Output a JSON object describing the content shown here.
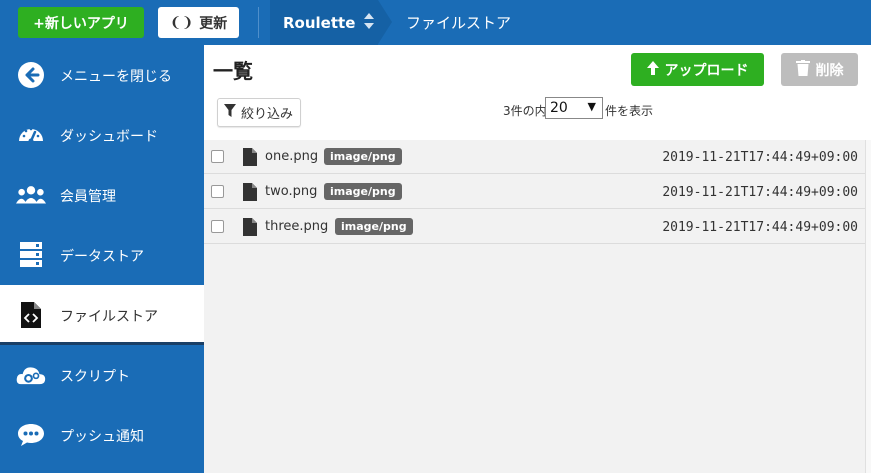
{
  "topbar": {
    "new_app_label": "+新しいアプリ",
    "refresh_label": "更新",
    "app_name": "Roulette",
    "breadcrumb": "ファイルストア"
  },
  "sidebar": {
    "items": [
      {
        "label": "メニューを閉じる",
        "icon": "arrow-left-circle-icon"
      },
      {
        "label": "ダッシュボード",
        "icon": "gauge-icon"
      },
      {
        "label": "会員管理",
        "icon": "users-icon"
      },
      {
        "label": "データストア",
        "icon": "database-icon"
      },
      {
        "label": "ファイルストア",
        "icon": "file-code-icon"
      },
      {
        "label": "スクリプト",
        "icon": "cloud-gears-icon"
      },
      {
        "label": "プッシュ通知",
        "icon": "chat-bubble-icon"
      }
    ]
  },
  "main": {
    "title": "一覧",
    "upload_label": "アップロード",
    "delete_label": "削除",
    "filter_label": "絞り込み",
    "count_text": "3件の内",
    "per_page_value": "20",
    "show_text": "件を表示",
    "files": [
      {
        "name": "one.png",
        "type": "image/png",
        "date": "2019-11-21T17:44:49+09:00"
      },
      {
        "name": "two.png",
        "type": "image/png",
        "date": "2019-11-21T17:44:49+09:00"
      },
      {
        "name": "three.png",
        "type": "image/png",
        "date": "2019-11-21T17:44:49+09:00"
      }
    ]
  },
  "colors": {
    "primary_blue": "#1a6cb6",
    "green": "#2eaf21",
    "disabled_gray": "#bdbdbd"
  }
}
